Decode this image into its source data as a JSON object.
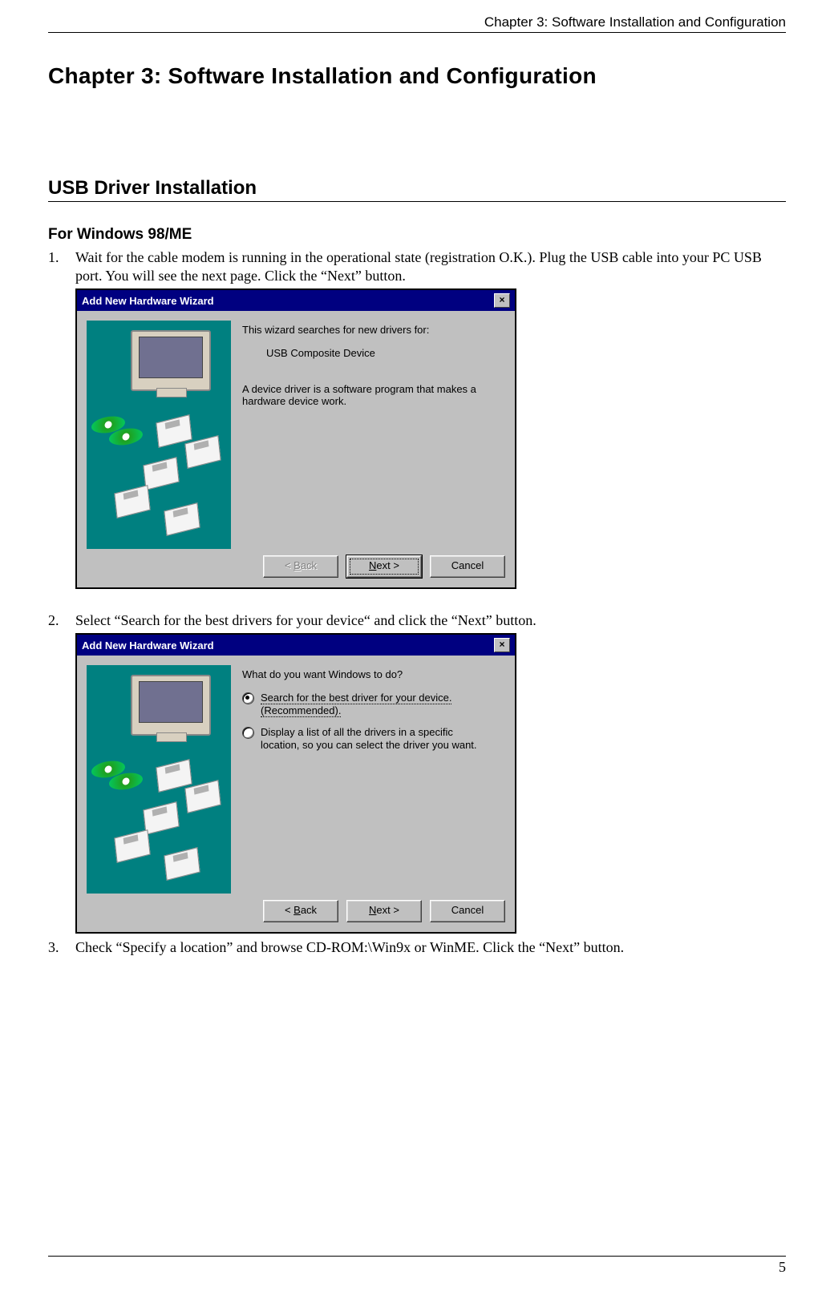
{
  "header": "Chapter 3: Software Installation and Configuration",
  "chapter_title": "Chapter 3: Software Installation and Configuration",
  "section_title": "USB Driver Installation",
  "sub_title": "For Windows 98/ME",
  "steps": {
    "s1_num": "1.",
    "s1_text": "Wait for the cable modem is running in the operational state (registration O.K.). Plug the USB cable into your PC USB port. You will see the next page. Click the “Next” button.",
    "s2_num": "2.",
    "s2_text": "Select “Search for the best drivers for your device“ and click the “Next” button.",
    "s3_num": "3.",
    "s3_text": "Check “Specify a location” and browse CD-ROM:\\Win9x or WinME. Click the “Next” button."
  },
  "dialog1": {
    "title": "Add New Hardware Wizard",
    "line1": "This wizard searches for new drivers for:",
    "device": "USB Composite Device",
    "line2": "A device driver is a software program that makes a hardware device work.",
    "back": "< Back",
    "next": "Next >",
    "cancel": "Cancel"
  },
  "dialog2": {
    "title": "Add New Hardware Wizard",
    "prompt": "What do you want Windows to do?",
    "opt1": "Search for the best driver for your device. (Recommended).",
    "opt2": "Display a list of all the drivers in a specific location, so you can select the driver you want.",
    "back": "< Back",
    "next": "Next >",
    "cancel": "Cancel"
  },
  "page_number": "5"
}
